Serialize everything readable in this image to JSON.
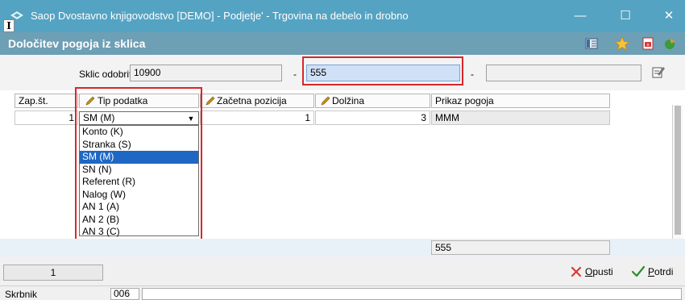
{
  "window": {
    "title": "Saop Dvostavno knjigovodstvo [DEMO] - Podjetje' - Trgovina na debelo in drobno",
    "minimize": "—",
    "maximize": "☐",
    "close": "✕"
  },
  "header": {
    "title": "Določitev pogoja iz sklica"
  },
  "form": {
    "sklic_label": "Sklic odobritve",
    "sklic_value": "10900",
    "sep1": "-",
    "field2_value": "555",
    "sep2": "-",
    "field3_value": ""
  },
  "grid": {
    "columns": [
      "Zap.št.",
      "Tip podatka",
      "Začetna pozicija",
      "Dolžina",
      "Prikaz pogoja"
    ],
    "row": {
      "zap": "1",
      "tip": "SM (M)",
      "zacetna": "1",
      "dolzina": "3",
      "prikaz": "MMM"
    },
    "dropdown_options": [
      "Konto (K)",
      "Stranka (S)",
      "SM (M)",
      "SN (N)",
      "Referent (R)",
      "Nalog (W)",
      "AN 1 (A)",
      "AN 2 (B)",
      "AN 3 (C)"
    ],
    "selected_option": "SM (M)",
    "summary_value": "555"
  },
  "footer": {
    "page_number": "1",
    "cancel_label_prefix": "",
    "cancel_label_underlined": "O",
    "cancel_label_rest": "pusti",
    "confirm_label_underlined": "P",
    "confirm_label_rest": "otrdi"
  },
  "statusbar": {
    "label": "Skrbnik",
    "value": "006"
  },
  "colors": {
    "titlebar": "#54a3c3",
    "subheader": "#6d9fb5",
    "highlight": "#d9262c",
    "selection": "#1e67c3"
  }
}
